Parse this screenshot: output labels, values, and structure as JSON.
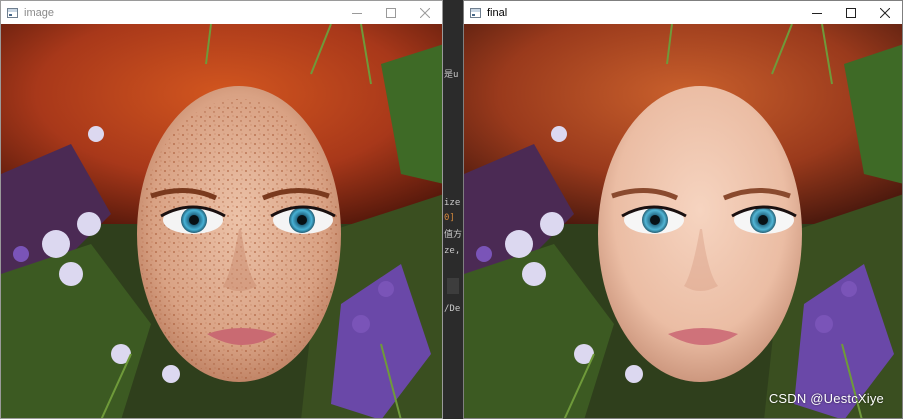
{
  "windows": {
    "left": {
      "title": "image"
    },
    "right": {
      "title": "final"
    }
  },
  "controls": {
    "minimize": "—",
    "maximize": "☐",
    "close": "✕"
  },
  "background_code": [
    "是u",
    "ize",
    "0]",
    "值方",
    "ze,",
    "/De"
  ],
  "watermark": "CSDN @UestcXiye",
  "colors": {
    "hair": "#b8441a",
    "skin": "#e6b59c",
    "skin_smooth": "#f0c8b4",
    "eyes": "#3fa6c8",
    "lips": "#c96a72",
    "flowers": "#7a54b8",
    "foliage": "#3f6a24"
  }
}
